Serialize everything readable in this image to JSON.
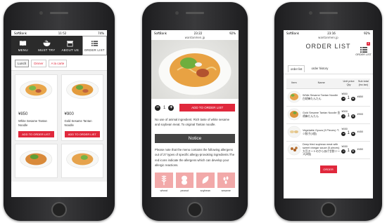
{
  "phone1": {
    "status": {
      "carrier": "SoftBank",
      "time": "11:52",
      "battery": "74%"
    },
    "nav": [
      {
        "label": "MENU",
        "icon": "book-icon"
      },
      {
        "label": "MUST TRY",
        "icon": "bowl-icon"
      },
      {
        "label": "ABOUT US",
        "icon": "shop-icon"
      },
      {
        "label": "ORDER LIST",
        "icon": "list-icon"
      }
    ],
    "tabs": [
      "Lunch",
      "Dinner",
      "A la carte"
    ],
    "products": [
      {
        "price": "¥850",
        "name": "White Sesame Tantan Noodle",
        "button": "ADD TO ORDER LIST"
      },
      {
        "price": "¥900",
        "name": "Gold Sesame Tantan Noodle",
        "button": "ADD TO ORDER LIST"
      }
    ]
  },
  "phone2": {
    "status": {
      "carrier": "SoftBank",
      "time": "23:22",
      "battery": "92%"
    },
    "url": "wantanmen.jp",
    "quantity": "1",
    "add_button": "ADD TO ORDER LIST",
    "description": "No use of animal ingredient. Rich taste of white sesame and soybean meat. To original Tantan noodle.",
    "notice_title": "Notice",
    "notice_text": "Please note that the menu contains the following allergens out of 27 types of specific allergy-provoking ingredients.The red icons indicate the allergens which can develop your allergic reactions.",
    "allergens": [
      "wheat",
      "peanut",
      "soybean",
      "sesame"
    ]
  },
  "phone3": {
    "status": {
      "carrier": "SoftBank",
      "time": "23:16",
      "battery": "92%"
    },
    "url": "wantanmen.jp",
    "title": "ORDER LIST",
    "badge": "4",
    "order_list_label": "ORDER LIST",
    "tabs": [
      "order list",
      "order history"
    ],
    "headers": {
      "item": "Item",
      "name": "Name",
      "price": "Unit price Qty",
      "subtotal": "Sub total (inc.tax)"
    },
    "rows": [
      {
        "name": "White Sesame Tantan Noodle 白胡麻たんたん",
        "price": "¥850",
        "qty": "1",
        "subtotal": "¥850"
      },
      {
        "name": "Gold Sesame Tantan Noodle 金胡麻たんたん",
        "price": "¥900",
        "qty": "1",
        "subtotal": "¥900"
      },
      {
        "name": "Vegetable Gyoza (3 Pieces) ベジ餃子(3個)",
        "price": "¥450",
        "qty": "1",
        "subtotal": "¥450"
      },
      {
        "name": "Deep fried soybean meat with sweet vinegar sauce (5 pieces) 大豆ミートのからあげ甘酢ソース(5個)",
        "price": "¥450",
        "qty": "1",
        "subtotal": "¥450"
      }
    ],
    "order_button": "ORDER"
  }
}
